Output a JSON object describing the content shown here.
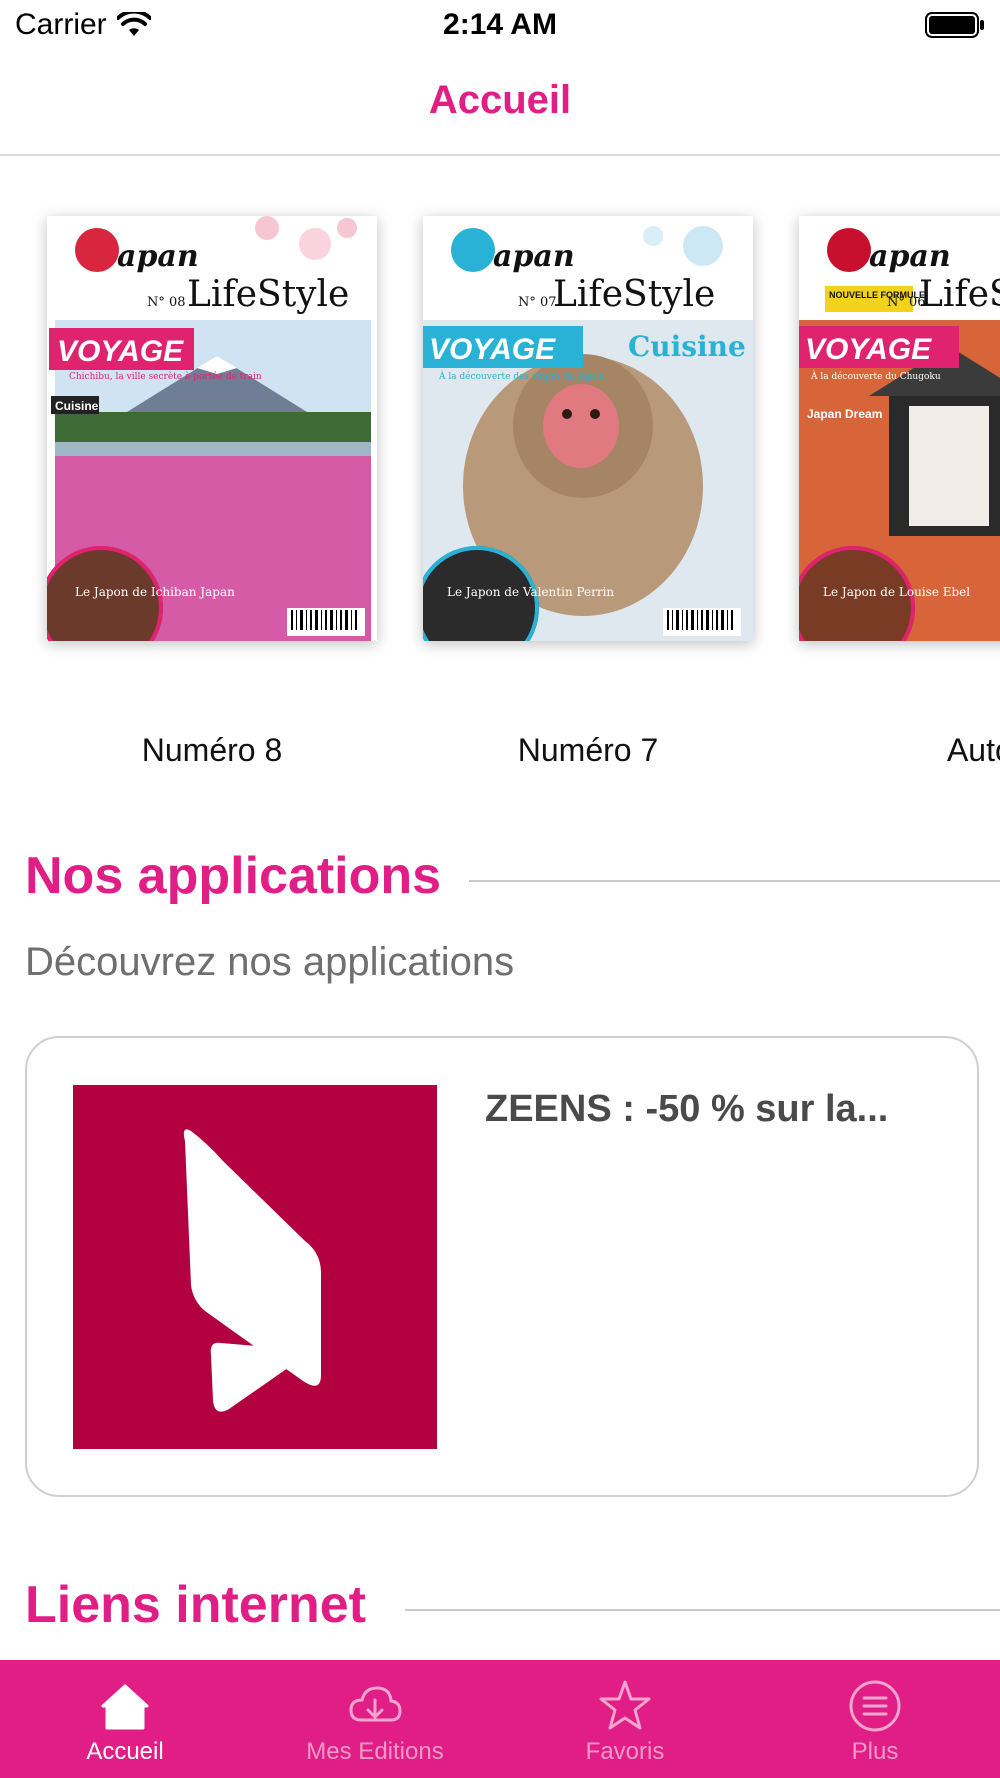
{
  "colors": {
    "accent": "#e01e85",
    "tab_bar_bg": "#e01e85",
    "app_icon_bg": "#b3003f",
    "section_rule": "#c9c9c9"
  },
  "status_bar": {
    "carrier": "Carrier",
    "time": "2:14 AM",
    "wifi_icon": "wifi-icon",
    "battery_icon": "battery-icon"
  },
  "nav": {
    "title": "Accueil"
  },
  "editions": [
    {
      "label": "Numéro 8",
      "cover": {
        "brand": "apan",
        "brand_sub": "LifeStyle",
        "issue": "N° 08",
        "headline": "VOYAGE",
        "tagline": "Chichibu, la ville secrète à portée de train",
        "section": "Cuisine",
        "teaser": "Le Japon de Ichiban Japan"
      }
    },
    {
      "label": "Numéro 7",
      "cover": {
        "brand": "apan",
        "brand_sub": "LifeStyle",
        "issue": "N° 07",
        "headline": "VOYAGE",
        "tagline": "À la découverte des singes du Japon",
        "section": "Cuisine",
        "teaser": "Le Japon de Valentin Perrin"
      }
    },
    {
      "label": "Automne",
      "cover": {
        "brand": "apan",
        "brand_sub": "LifeStyle",
        "issue": "N° 06",
        "badge": "NOUVELLE FORMULE",
        "headline": "VOYAGE",
        "tagline": "À la découverte du Chugoku",
        "section": "Japan Dream",
        "teaser": "Le Japon de Louise Ebel"
      }
    }
  ],
  "apps_section": {
    "title": "Nos applications",
    "subtitle": "Découvrez nos applications"
  },
  "app_card": {
    "name": "ZEENS : -50 % sur la...",
    "icon": "zeens-logo-icon"
  },
  "links_section": {
    "title": "Liens internet"
  },
  "tabs": [
    {
      "label": "Accueil",
      "icon": "home-icon",
      "active": true
    },
    {
      "label": "Mes Editions",
      "icon": "cloud-download-icon",
      "active": false
    },
    {
      "label": "Favoris",
      "icon": "star-icon",
      "active": false
    },
    {
      "label": "Plus",
      "icon": "menu-circle-icon",
      "active": false
    }
  ]
}
